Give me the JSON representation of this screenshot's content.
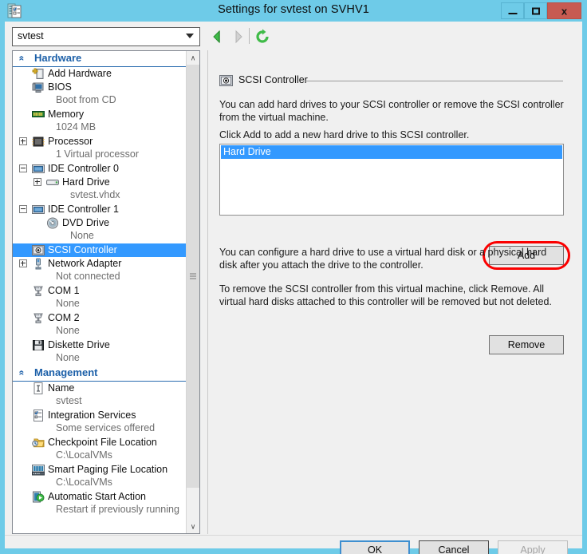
{
  "window": {
    "title": "Settings for svtest on SVHV1",
    "icon": "settings-document-icon",
    "minimize_label": "–",
    "maximize_label": "□",
    "close_label": "x"
  },
  "toolbar": {
    "vm_selector_value": "svtest",
    "back_label": "◀",
    "forward_label": "▶",
    "refresh_label": "↻"
  },
  "sidebar": {
    "scroll_up_label": "∧",
    "scroll_down_label": "∨",
    "sections": [
      {
        "label": "Hardware",
        "chevron": "«",
        "items": [
          {
            "label": "Add Hardware",
            "sub": "",
            "icon": "add-hardware-icon",
            "expander": "none",
            "indent": 0,
            "selected": false
          },
          {
            "label": "BIOS",
            "sub": "Boot from CD",
            "icon": "bios-icon",
            "expander": "none",
            "indent": 0,
            "selected": false
          },
          {
            "label": "Memory",
            "sub": "1024 MB",
            "icon": "memory-icon",
            "expander": "none",
            "indent": 0,
            "selected": false
          },
          {
            "label": "Processor",
            "sub": "1 Virtual processor",
            "icon": "processor-icon",
            "expander": "plus",
            "indent": 0,
            "selected": false
          },
          {
            "label": "IDE Controller 0",
            "sub": "",
            "icon": "ide-controller-icon",
            "expander": "minus",
            "indent": 0,
            "selected": false
          },
          {
            "label": "Hard Drive",
            "sub": "svtest.vhdx",
            "icon": "hard-drive-icon",
            "expander": "plus",
            "indent": 1,
            "selected": false
          },
          {
            "label": "IDE Controller 1",
            "sub": "",
            "icon": "ide-controller-icon",
            "expander": "minus",
            "indent": 0,
            "selected": false
          },
          {
            "label": "DVD Drive",
            "sub": "None",
            "icon": "dvd-drive-icon",
            "expander": "none",
            "indent": 1,
            "selected": false
          },
          {
            "label": "SCSI Controller",
            "sub": "",
            "icon": "scsi-controller-icon",
            "expander": "none",
            "indent": 0,
            "selected": true
          },
          {
            "label": "Network Adapter",
            "sub": "Not connected",
            "icon": "network-adapter-icon",
            "expander": "plus",
            "indent": 0,
            "selected": false
          },
          {
            "label": "COM 1",
            "sub": "None",
            "icon": "com-port-icon",
            "expander": "none",
            "indent": 0,
            "selected": false
          },
          {
            "label": "COM 2",
            "sub": "None",
            "icon": "com-port-icon",
            "expander": "none",
            "indent": 0,
            "selected": false
          },
          {
            "label": "Diskette Drive",
            "sub": "None",
            "icon": "diskette-drive-icon",
            "expander": "none",
            "indent": 0,
            "selected": false
          }
        ]
      },
      {
        "label": "Management",
        "chevron": "«",
        "items": [
          {
            "label": "Name",
            "sub": "svtest",
            "icon": "name-icon",
            "expander": "none",
            "indent": 0,
            "selected": false
          },
          {
            "label": "Integration Services",
            "sub": "Some services offered",
            "icon": "integration-services-icon",
            "expander": "none",
            "indent": 0,
            "selected": false
          },
          {
            "label": "Checkpoint File Location",
            "sub": "C:\\LocalVMs",
            "icon": "checkpoint-folder-icon",
            "expander": "none",
            "indent": 0,
            "selected": false
          },
          {
            "label": "Smart Paging File Location",
            "sub": "C:\\LocalVMs",
            "icon": "smart-paging-icon",
            "expander": "none",
            "indent": 0,
            "selected": false
          },
          {
            "label": "Automatic Start Action",
            "sub": "Restart if previously running",
            "icon": "automatic-start-icon",
            "expander": "none",
            "indent": 0,
            "selected": false
          }
        ]
      }
    ]
  },
  "panel": {
    "group_icon": "scsi-controller-icon",
    "group_title": "SCSI Controller",
    "paragraph_1": "You can add hard drives to your SCSI controller or remove the SCSI controller from the virtual machine.",
    "paragraph_2": "Click Add to add a new hard drive to this SCSI controller.",
    "paragraph_3": "You can configure a hard drive to use a virtual hard disk or a physical hard disk after you attach the drive to the controller.",
    "paragraph_4": "To remove the SCSI controller from this virtual machine, click Remove. All virtual hard disks attached to this controller will be removed but not deleted.",
    "drive_list": [
      "Hard Drive"
    ],
    "add_label": "Add",
    "remove_label": "Remove"
  },
  "footer": {
    "ok_label": "OK",
    "cancel_label": "Cancel",
    "apply_label": "Apply"
  },
  "colors": {
    "titlebar": "#6ecbe8",
    "close_button": "#c75b52",
    "selection_blue": "#3399ff",
    "section_header_blue": "#1b5fa8",
    "annotation_red": "#fb0000"
  }
}
